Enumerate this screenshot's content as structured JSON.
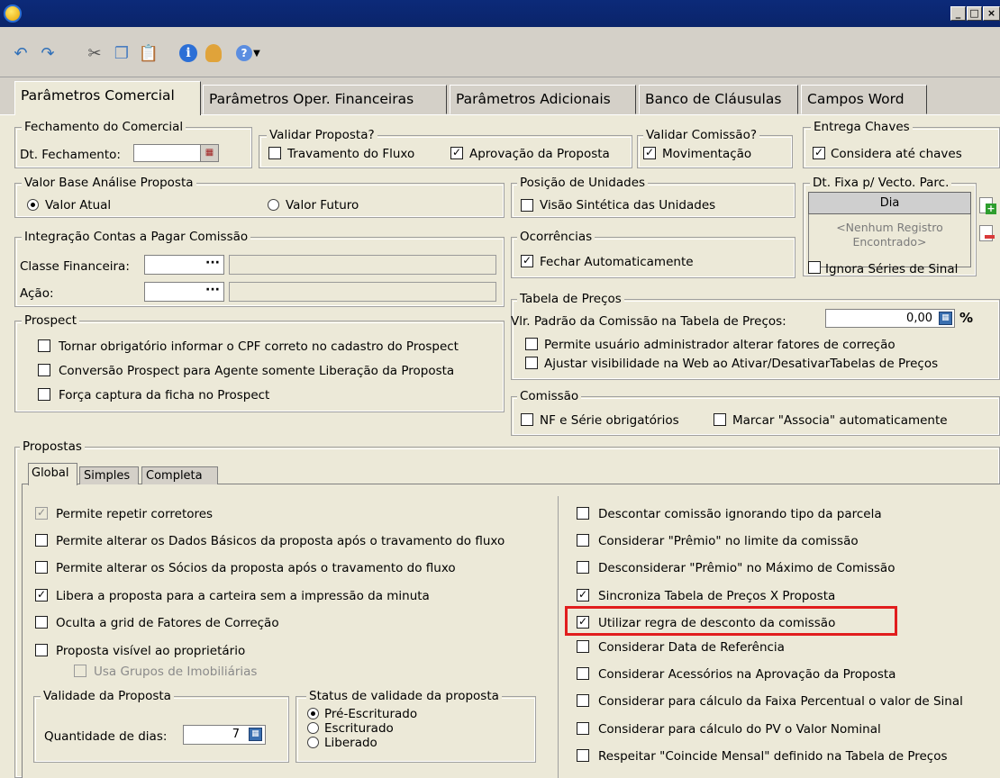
{
  "window": {
    "title": ""
  },
  "tabs": [
    {
      "label": "Parâmetros Comercial"
    },
    {
      "label": "Parâmetros Oper. Financeiras"
    },
    {
      "label": "Parâmetros Adicionais"
    },
    {
      "label": "Banco de Cláusulas"
    },
    {
      "label": "Campos Word"
    }
  ],
  "fechamento": {
    "legend": "Fechamento do Comercial",
    "dt_label": "Dt. Fechamento:",
    "dt_value": ""
  },
  "validar_proposta": {
    "legend": "Validar Proposta?",
    "travamento": "Travamento do Fluxo",
    "aprovacao": "Aprovação da Proposta"
  },
  "validar_comissao": {
    "legend": "Validar Comissão?",
    "movimentacao": "Movimentação"
  },
  "entrega_chaves": {
    "legend": "Entrega Chaves",
    "considera": "Considera até chaves"
  },
  "valor_base": {
    "legend": "Valor Base Análise Proposta",
    "atual": "Valor Atual",
    "futuro": "Valor Futuro"
  },
  "posicao": {
    "legend": "Posição de Unidades",
    "visao": "Visão Sintética das Unidades"
  },
  "dt_fixa": {
    "legend": "Dt. Fixa p/ Vecto. Parc.",
    "header": "Dia",
    "empty": "<Nenhum Registro Encontrado>",
    "ignora": "Ignora Séries de Sinal"
  },
  "integracao": {
    "legend": "Integração Contas a Pagar Comissão",
    "classe": "Classe Financeira:",
    "acao": "Ação:",
    "ellipsis": "···"
  },
  "ocorrencias": {
    "legend": "Ocorrências",
    "fechar": "Fechar Automaticamente"
  },
  "tabela_precos": {
    "legend": "Tabela de Preços",
    "vlr_label": "Vlr. Padrão da Comissão na Tabela de Preços:",
    "vlr_value": "0,00",
    "percent": "%",
    "permite": "Permite usuário administrador alterar fatores de correção",
    "ajustar": "Ajustar visibilidade na Web ao Ativar/DesativarTabelas de Preços"
  },
  "prospect": {
    "legend": "Prospect",
    "items": [
      "Tornar obrigatório informar o CPF correto no cadastro do Prospect",
      "Conversão Prospect para Agente somente Liberação da Proposta",
      "Força captura da ficha no Prospect"
    ]
  },
  "comissao": {
    "legend": "Comissão",
    "nf": "NF e Série obrigatórios",
    "marcar": "Marcar \"Associa\" automaticamente"
  },
  "propostas": {
    "legend": "Propostas",
    "subtabs": [
      "Global",
      "Simples",
      "Completa"
    ],
    "left": [
      "Permite repetir corretores",
      "Permite alterar os Dados Básicos da proposta após o travamento do fluxo",
      "Permite alterar os Sócios da proposta após o travamento do fluxo",
      "Libera a proposta para a carteira sem a impressão da minuta",
      "Oculta a grid de Fatores de Correção",
      "Proposta visível ao proprietário",
      "Usa Grupos de Imobiliárias"
    ],
    "right": [
      "Descontar comissão ignorando tipo da parcela",
      "Considerar \"Prêmio\" no limite da comissão",
      "Desconsiderar \"Prêmio\" no Máximo de Comissão",
      "Sincroniza Tabela de Preços X Proposta",
      "Utilizar regra de desconto da comissão",
      "Considerar Data de Referência",
      "Considerar Acessórios na Aprovação da Proposta",
      "Considerar para cálculo da Faixa Percentual o valor de Sinal",
      "Considerar para cálculo do PV o Valor Nominal",
      "Respeitar \"Coincide Mensal\" definido na Tabela de Preços"
    ],
    "validade": {
      "legend": "Validade da Proposta",
      "qtd_label": "Quantidade de dias:",
      "qtd_value": "7"
    },
    "status": {
      "legend": "Status de validade da proposta",
      "options": [
        "Pré-Escriturado",
        "Escriturado",
        "Liberado"
      ]
    }
  },
  "colors": {
    "title": "#0a246a",
    "face": "#d4d0c8",
    "panel": "#ece9d8",
    "highlight": "#e11d1d"
  }
}
